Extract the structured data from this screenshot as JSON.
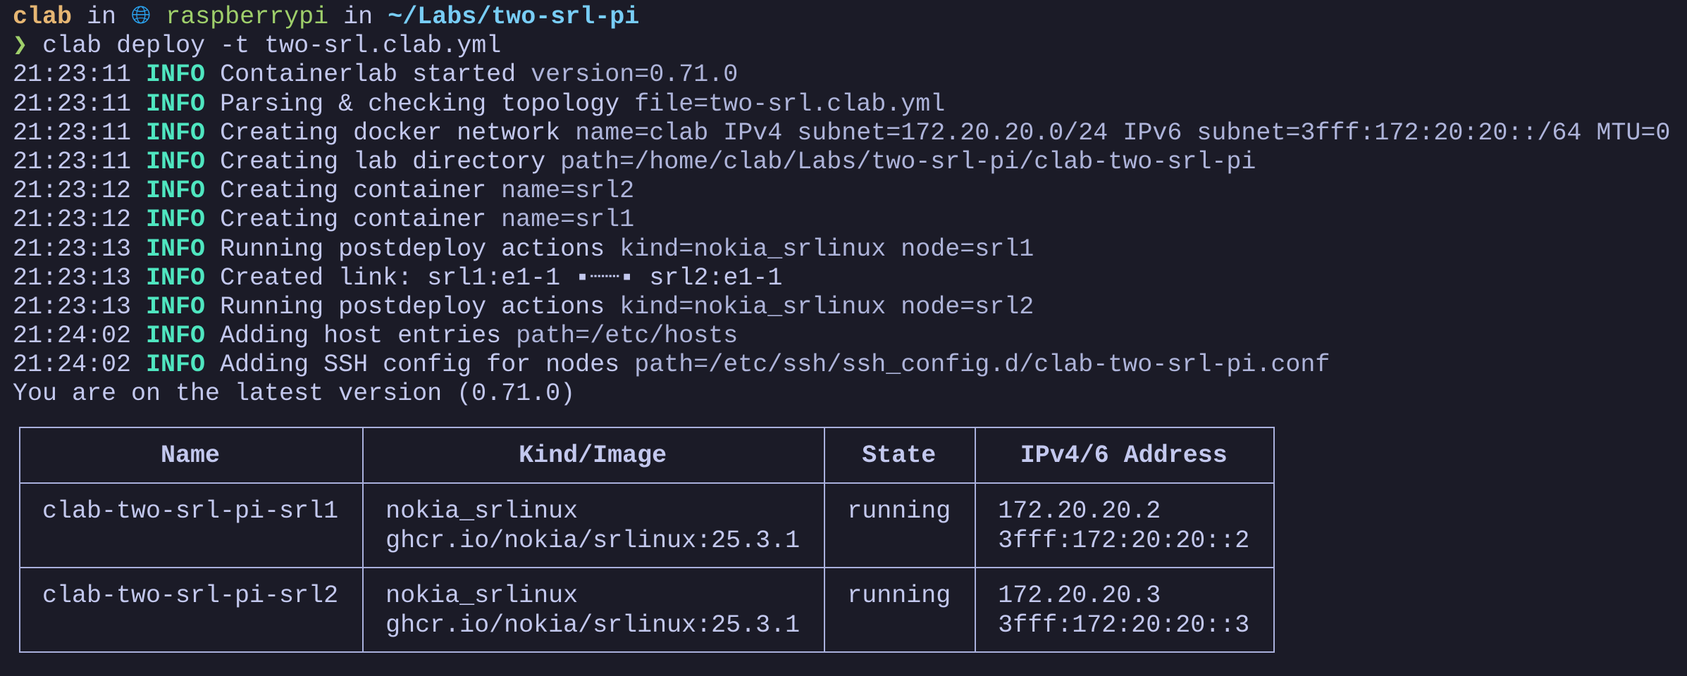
{
  "prompt": {
    "user": "clab",
    "in1": "in",
    "globe_icon": "globe-icon",
    "host": "raspberrypi",
    "in2": "in",
    "path": "~/Labs/two-srl-pi",
    "chevron": "❯",
    "command": "clab deploy -t two-srl.clab.yml"
  },
  "logs": [
    {
      "time": "21:23:11",
      "level": "INFO",
      "msg": "Containerlab started",
      "fields": "version=0.71.0"
    },
    {
      "time": "21:23:11",
      "level": "INFO",
      "msg": "Parsing & checking topology",
      "fields": "file=two-srl.clab.yml"
    },
    {
      "time": "21:23:11",
      "level": "INFO",
      "msg": "Creating docker network",
      "fields": "name=clab IPv4 subnet=172.20.20.0/24 IPv6 subnet=3fff:172:20:20::/64 MTU=0"
    },
    {
      "time": "21:23:11",
      "level": "INFO",
      "msg": "Creating lab directory",
      "fields": "path=/home/clab/Labs/two-srl-pi/clab-two-srl-pi"
    },
    {
      "time": "21:23:12",
      "level": "INFO",
      "msg": "Creating container",
      "fields": "name=srl2"
    },
    {
      "time": "21:23:12",
      "level": "INFO",
      "msg": "Creating container",
      "fields": "name=srl1"
    },
    {
      "time": "21:23:13",
      "level": "INFO",
      "msg": "Running postdeploy actions",
      "fields": "kind=nokia_srlinux node=srl1"
    },
    {
      "time": "21:23:13",
      "level": "INFO",
      "msg": "Created link: srl1:e1-1 ▪┈┈▪ srl2:e1-1",
      "fields": ""
    },
    {
      "time": "21:23:13",
      "level": "INFO",
      "msg": "Running postdeploy actions",
      "fields": "kind=nokia_srlinux node=srl2"
    },
    {
      "time": "21:24:02",
      "level": "INFO",
      "msg": "Adding host entries",
      "fields": "path=/etc/hosts"
    },
    {
      "time": "21:24:02",
      "level": "INFO",
      "msg": "Adding SSH config for nodes",
      "fields": "path=/etc/ssh/ssh_config.d/clab-two-srl-pi.conf"
    }
  ],
  "version_msg": "You are on the latest version (0.71.0)",
  "table": {
    "headers": [
      "Name",
      "Kind/Image",
      "State",
      "IPv4/6 Address"
    ],
    "rows": [
      {
        "name": "clab-two-srl-pi-srl1",
        "kind": "nokia_srlinux",
        "image": "ghcr.io/nokia/srlinux:25.3.1",
        "state": "running",
        "ipv4": "172.20.20.2",
        "ipv6": "3fff:172:20:20::2"
      },
      {
        "name": "clab-two-srl-pi-srl2",
        "kind": "nokia_srlinux",
        "image": "ghcr.io/nokia/srlinux:25.3.1",
        "state": "running",
        "ipv4": "172.20.20.3",
        "ipv6": "3fff:172:20:20::3"
      }
    ]
  }
}
